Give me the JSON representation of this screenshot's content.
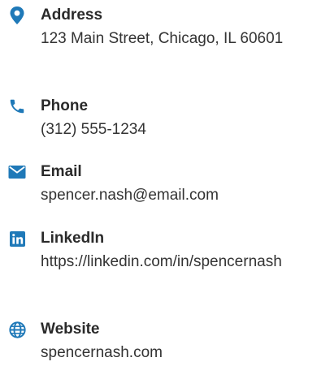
{
  "accent_color": "#1f79b8",
  "contacts": [
    {
      "icon": "map-pin-icon",
      "label": "Address",
      "value": "123 Main Street, Chicago, IL 60601"
    },
    {
      "icon": "phone-icon",
      "label": "Phone",
      "value": "(312) 555-1234"
    },
    {
      "icon": "envelope-icon",
      "label": "Email",
      "value": "spencer.nash@email.com"
    },
    {
      "icon": "linkedin-icon",
      "label": "LinkedIn",
      "value": "https://linkedin.com/in/spencernash"
    },
    {
      "icon": "globe-icon",
      "label": "Website",
      "value": "spencernash.com"
    }
  ]
}
